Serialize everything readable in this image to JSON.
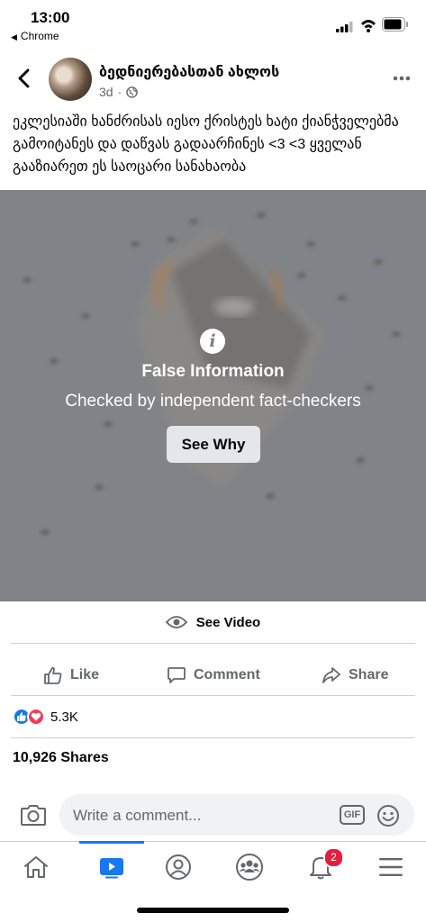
{
  "status_bar": {
    "time": "13:00",
    "back_app": "Chrome"
  },
  "post": {
    "author": "ბედნიერებასთან ახლოს",
    "time_ago": "3d",
    "separator": "·",
    "caption": "ეკლესიაში ხანძრისას იესო ქრისტეს ხატი ქიანჭველებმა გამოიტანეს და დაწვას გადაარჩინეს <3 <3 ყველან გააზიარეთ ეს საოცარი სანახაობა"
  },
  "overlay": {
    "title": "False Information",
    "subtitle": "Checked by independent fact-checkers",
    "button": "See Why"
  },
  "see_video": "See Video",
  "actions": {
    "like": "Like",
    "comment": "Comment",
    "share": "Share"
  },
  "reactions": {
    "count": "5.3K"
  },
  "shares": "10,926 Shares",
  "comment_bar": {
    "placeholder": "Write a comment...",
    "gif": "GIF"
  },
  "tabbar": {
    "notifications_badge": "2",
    "active_tab": "video"
  },
  "colors": {
    "brand": "#1877f2",
    "badge": "#e41e3f",
    "love": "#f33e58",
    "muted": "#65676b"
  }
}
